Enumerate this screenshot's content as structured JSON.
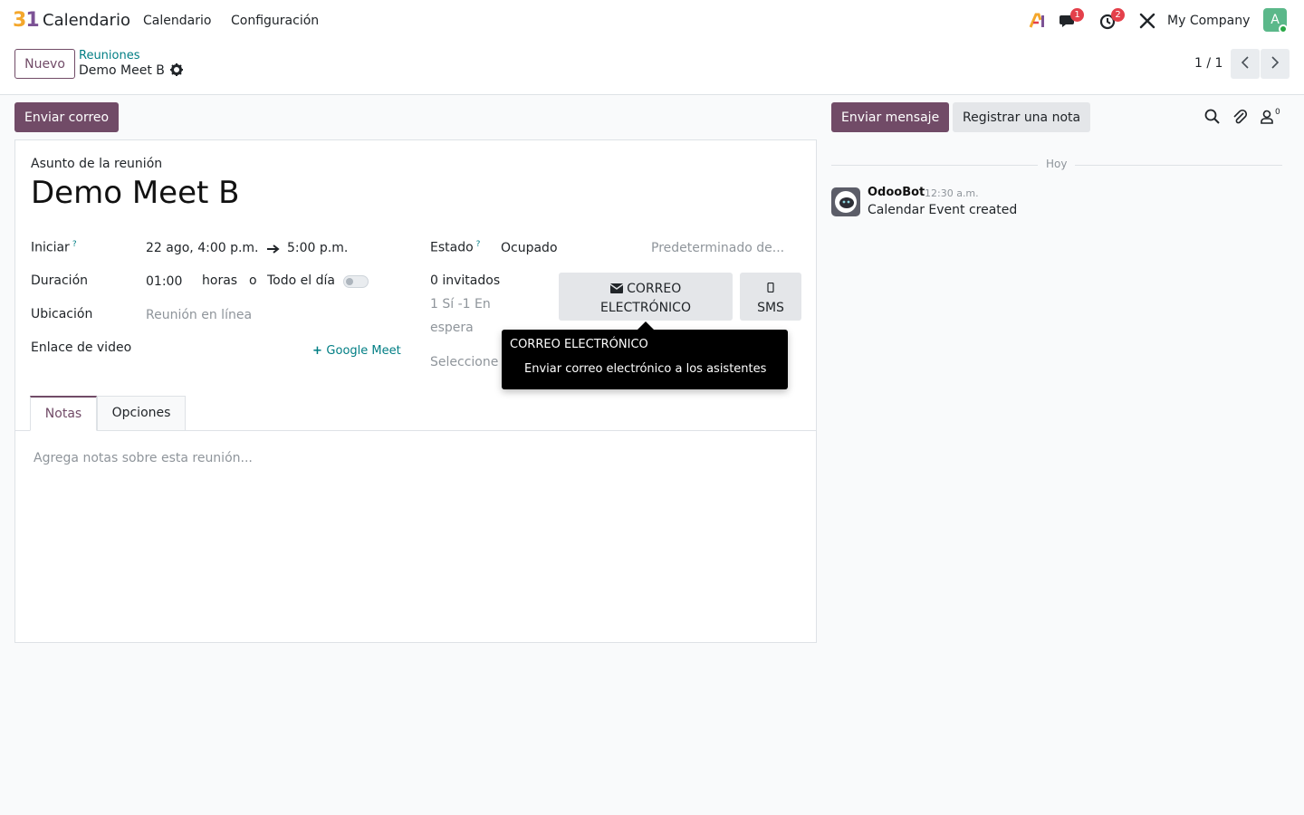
{
  "navbar": {
    "app_logo": "31",
    "app_name": "Calendario",
    "menu": [
      "Calendario",
      "Configuración"
    ],
    "chat_badge": "1",
    "activity_badge": "2",
    "company": "My Company",
    "avatar_initial": "A",
    "colors": {
      "brand": "#714b67",
      "avatar": "#5bb88a",
      "badge": "#e4404b"
    }
  },
  "control": {
    "new_label": "Nuevo",
    "breadcrumb_parent": "Reuniones",
    "breadcrumb_current": "Demo Meet B",
    "pager": "1 / 1"
  },
  "form": {
    "send_email_label": "Enviar correo",
    "subject_label": "Asunto de la reunión",
    "title": "Demo Meet B",
    "start_label": "Iniciar",
    "start_date": "22 ago, 4:00 p.m.",
    "end_time": "5:00 p.m.",
    "duration_label": "Duración",
    "duration_value": "01:00",
    "hours_label": "horas",
    "or_label": "o",
    "allday_label": "Todo el día",
    "location_label": "Ubicación",
    "location_placeholder": "Reunión en línea",
    "video_label": "Enlace de video",
    "gmeet_label": "Google Meet",
    "status_label": "Estado",
    "status_value": "Ocupado",
    "privacy_placeholder": "Predeterminado de...",
    "attendees_count": "0 invitados",
    "attendees_summary_1": "1 Sí  -1 En",
    "attendees_summary_2": "espera",
    "attendees_select": "Seleccione",
    "email_btn_1": "CORREO",
    "email_btn_2": "ELECTRÓNICO",
    "sms_label": "SMS",
    "tab_notes": "Notas",
    "tab_options": "Opciones",
    "notes_placeholder": "Agrega notas sobre esta reunión..."
  },
  "tooltip": {
    "title": "CORREO ELECTRÓNICO",
    "body": "Enviar correo electrónico a los asistentes"
  },
  "chatter": {
    "send_message_label": "Enviar mensaje",
    "log_note_label": "Registrar una nota",
    "followers_count": "0",
    "date_separator": "Hoy",
    "message": {
      "author": "OdooBot",
      "time": "12:30 a.m.",
      "body": "Calendar Event created"
    }
  }
}
